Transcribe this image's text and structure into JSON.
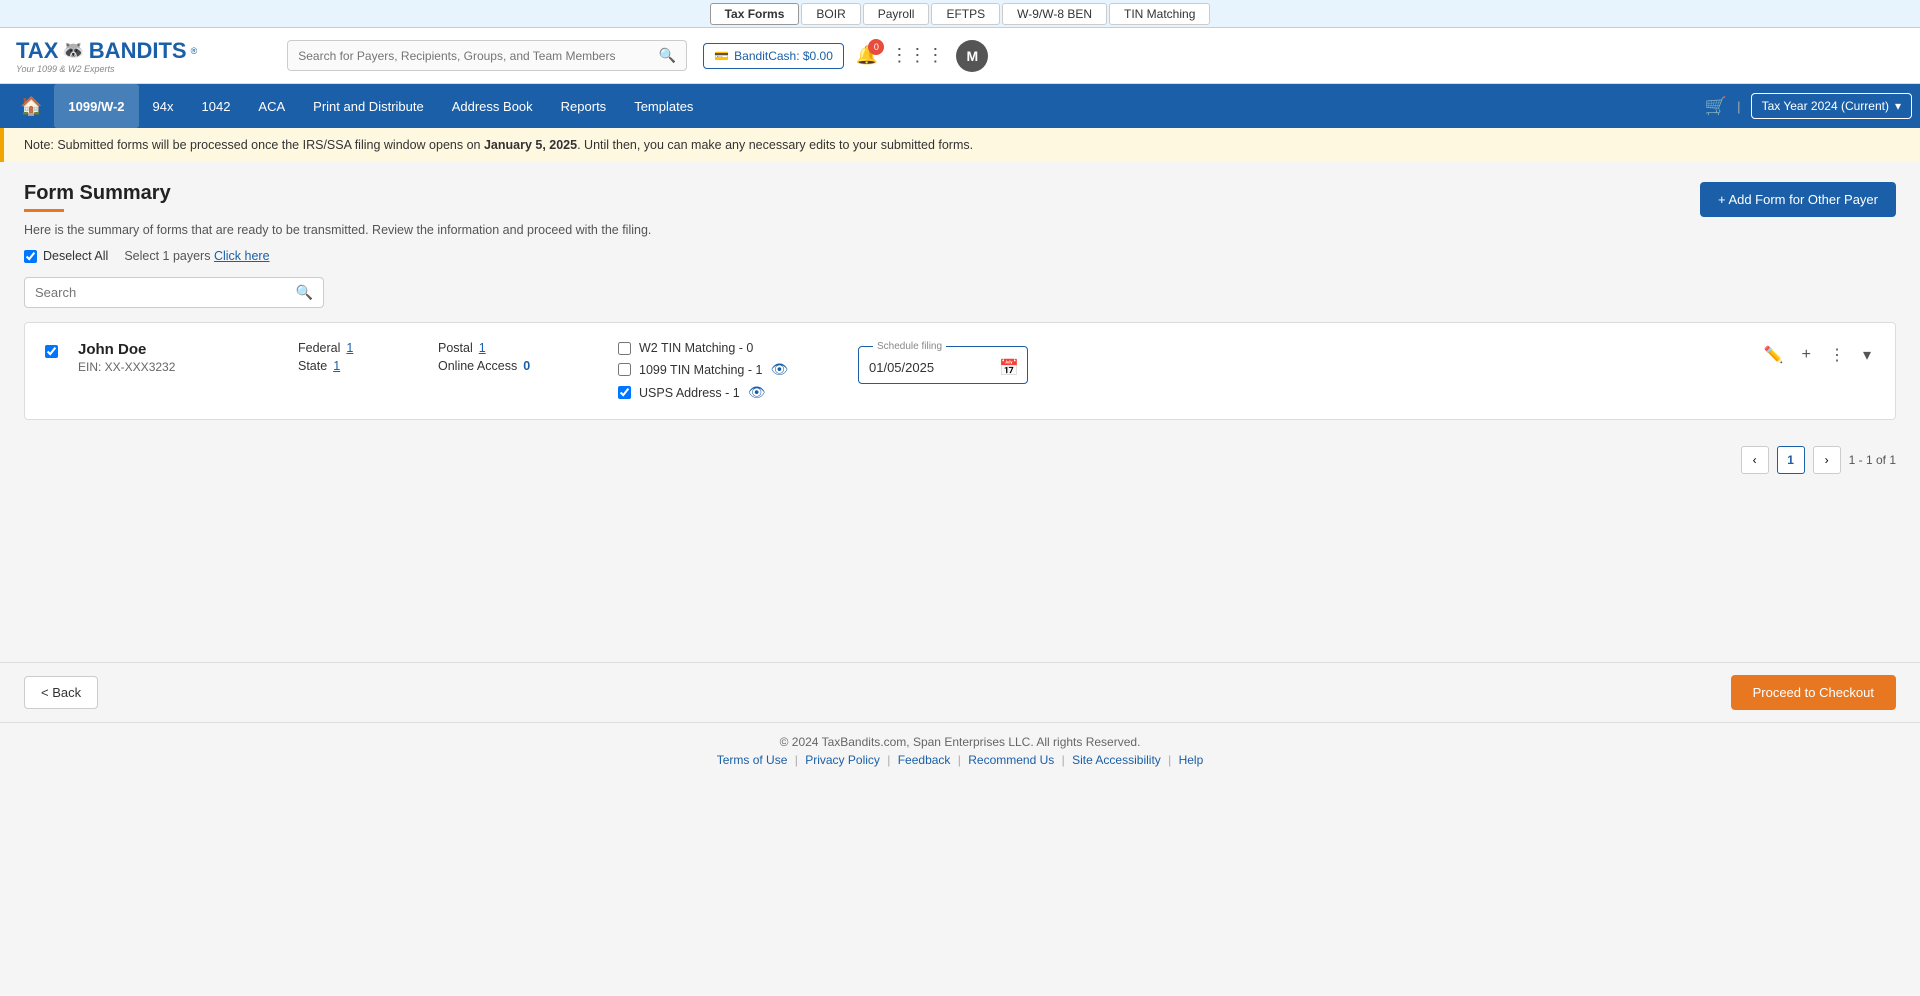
{
  "topNav": {
    "items": [
      {
        "label": "Tax Forms",
        "active": true
      },
      {
        "label": "BOIR",
        "active": false
      },
      {
        "label": "Payroll",
        "active": false
      },
      {
        "label": "EFTPS",
        "active": false
      },
      {
        "label": "W-9/W-8 BEN",
        "active": false
      },
      {
        "label": "TIN Matching",
        "active": false
      }
    ]
  },
  "header": {
    "logo": {
      "brand": "TAXBANDITS",
      "registered": "®",
      "tagline": "Your 1099 & W2 Experts"
    },
    "search": {
      "placeholder": "Search for Payers, Recipients, Groups, and Team Members"
    },
    "banditCash": {
      "label": "BanditCash: $0.00"
    },
    "notifCount": "0",
    "avatar": "M"
  },
  "mainNav": {
    "items": [
      {
        "label": "1099/W-2",
        "active": true
      },
      {
        "label": "94x",
        "active": false
      },
      {
        "label": "1042",
        "active": false
      },
      {
        "label": "ACA",
        "active": false
      },
      {
        "label": "Print and Distribute",
        "active": false
      },
      {
        "label": "Address Book",
        "active": false
      },
      {
        "label": "Reports",
        "active": false
      },
      {
        "label": "Templates",
        "active": false
      }
    ],
    "taxYear": "Tax Year 2024 (Current)"
  },
  "notice": {
    "text": "Note: Submitted forms will be processed once the IRS/SSA filing window opens on ",
    "date": "January 5, 2025",
    "text2": ". Until then, you can make any necessary edits to your submitted forms."
  },
  "page": {
    "title": "Form Summary",
    "subtitle": "Here is the summary of forms that are ready to be transmitted. Review the information and proceed with the filing.",
    "deselectAll": "Deselect All",
    "selectLabel": "Select 1 payers",
    "clickHere": "Click here",
    "addFormBtn": "+ Add Form for Other Payer",
    "searchPlaceholder": "Search"
  },
  "payers": [
    {
      "name": "John Doe",
      "ein": "EIN: XX-XXX3232",
      "federal": "1",
      "state": "1",
      "postal": "1",
      "onlineAccess": "0",
      "w2TinMatching": "W2 TIN Matching - 0",
      "w2TinChecked": false,
      "tin1099Matching": "1099 TIN Matching - 1",
      "tin1099Checked": false,
      "uspsAddress": "USPS Address - 1",
      "uspsChecked": true,
      "scheduleDate": "01/05/2025"
    }
  ],
  "pagination": {
    "currentPage": 1,
    "totalPages": 1,
    "rangeText": "1 - 1 of 1"
  },
  "footer": {
    "copyright": "© 2024 TaxBandits.com, Span Enterprises LLC. All rights Reserved.",
    "links": [
      {
        "label": "Terms of Use"
      },
      {
        "label": "Privacy Policy"
      },
      {
        "label": "Feedback"
      },
      {
        "label": "Recommend Us"
      },
      {
        "label": "Site Accessibility"
      },
      {
        "label": "Help"
      }
    ]
  },
  "buttons": {
    "back": "< Back",
    "proceed": "Proceed to Checkout"
  }
}
